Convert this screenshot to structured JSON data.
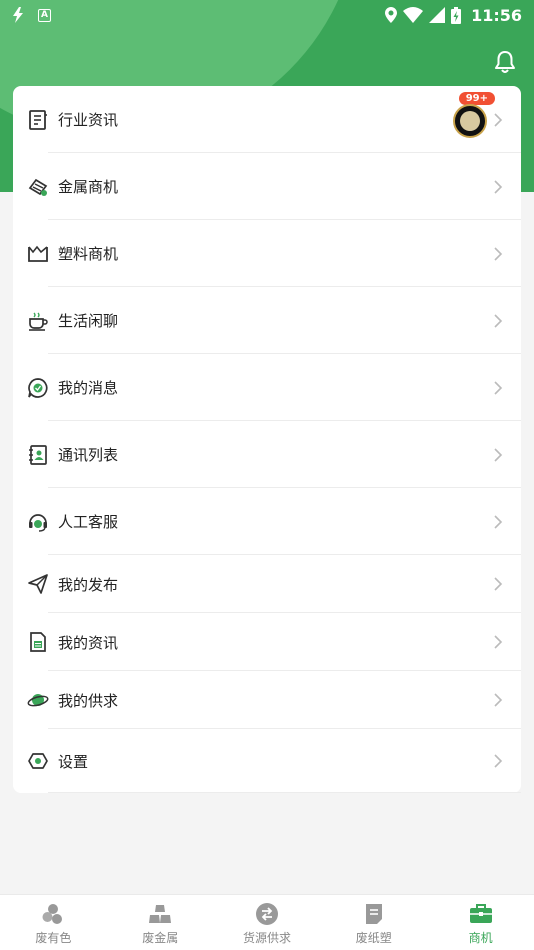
{
  "status_bar": {
    "time": "11:56",
    "left_icons": [
      "flash-icon",
      "a-icon"
    ],
    "right_icons": [
      "location-icon",
      "wifi-icon",
      "signal-icon",
      "battery-charging-icon"
    ]
  },
  "header": {
    "bell_icon": "bell-icon"
  },
  "notifications": {
    "badge": "99+"
  },
  "menu": [
    {
      "label": "行业资讯",
      "icon": "news-icon"
    },
    {
      "label": "金属商机",
      "icon": "metal-bars-icon"
    },
    {
      "label": "塑料商机",
      "icon": "plastic-box-icon"
    },
    {
      "label": "生活闲聊",
      "icon": "coffee-icon"
    },
    {
      "label": "我的消息",
      "icon": "chat-bubble-icon"
    },
    {
      "label": "通讯列表",
      "icon": "contacts-icon"
    },
    {
      "label": "人工客服",
      "icon": "headset-icon"
    },
    {
      "label": "我的发布",
      "icon": "paper-plane-icon"
    },
    {
      "label": "我的资讯",
      "icon": "document-icon"
    },
    {
      "label": "我的供求",
      "icon": "planet-icon"
    },
    {
      "label": "设置",
      "icon": "settings-icon"
    }
  ],
  "tabs": [
    {
      "label": "废有色",
      "icon": "nonferrous-icon"
    },
    {
      "label": "废金属",
      "icon": "metal-icon"
    },
    {
      "label": "货源供求",
      "icon": "exchange-icon"
    },
    {
      "label": "废纸塑",
      "icon": "paper-icon"
    },
    {
      "label": "商机",
      "icon": "briefcase-icon"
    }
  ],
  "colors": {
    "primary": "#3aa658",
    "primary_light": "#5dbd74",
    "badge": "#f15033",
    "inactive": "#888888"
  }
}
